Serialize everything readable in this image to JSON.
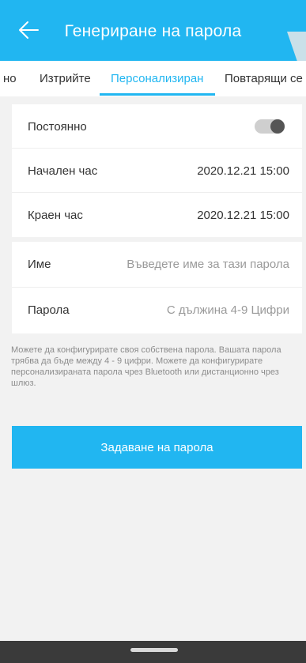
{
  "header": {
    "title": "Генериране на парола",
    "back_icon": "arrow-left-icon",
    "background": "#21b6f1"
  },
  "tabs": [
    {
      "label": "но",
      "active": false
    },
    {
      "label": "Изтрийте",
      "active": false
    },
    {
      "label": "Персонализиран",
      "active": true
    },
    {
      "label": "Повтарящи се",
      "active": false
    }
  ],
  "settings": {
    "permanent": {
      "label": "Постоянно",
      "enabled": false
    },
    "start": {
      "label": "Начален час",
      "value": "2020.12.21 15:00"
    },
    "end": {
      "label": "Краен час",
      "value": "2020.12.21 15:00"
    }
  },
  "fields": {
    "name": {
      "label": "Име",
      "placeholder": "Въведете име за тази парола"
    },
    "password": {
      "label": "Парола",
      "placeholder": "С дължина 4-9 Цифри"
    }
  },
  "info_text": "Можете да конфигурирате своя собствена парола. Вашата парола трябва да бъде между 4 - 9 цифри. Можете да конфигурирате персонализираната парола чрез Bluetooth или дистанционно чрез шлюз.",
  "action_button": {
    "label": "Задаване на парола"
  },
  "colors": {
    "accent": "#21b6f1",
    "background": "#f2f2f2"
  }
}
